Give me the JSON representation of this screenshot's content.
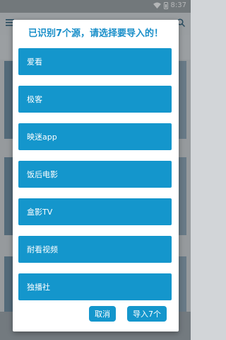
{
  "status_bar": {
    "time": "8:37"
  },
  "dialog": {
    "title": "已识别7个源，请选择要导入的！",
    "sources": [
      "爱看",
      "极客",
      "映迷app",
      "饭后电影",
      "盒影TV",
      "耐看视频",
      "独播社"
    ],
    "cancel_label": "取消",
    "import_label": "导入7个"
  },
  "colors": {
    "accent": "#1496cc",
    "title": "#1a8fc9"
  }
}
